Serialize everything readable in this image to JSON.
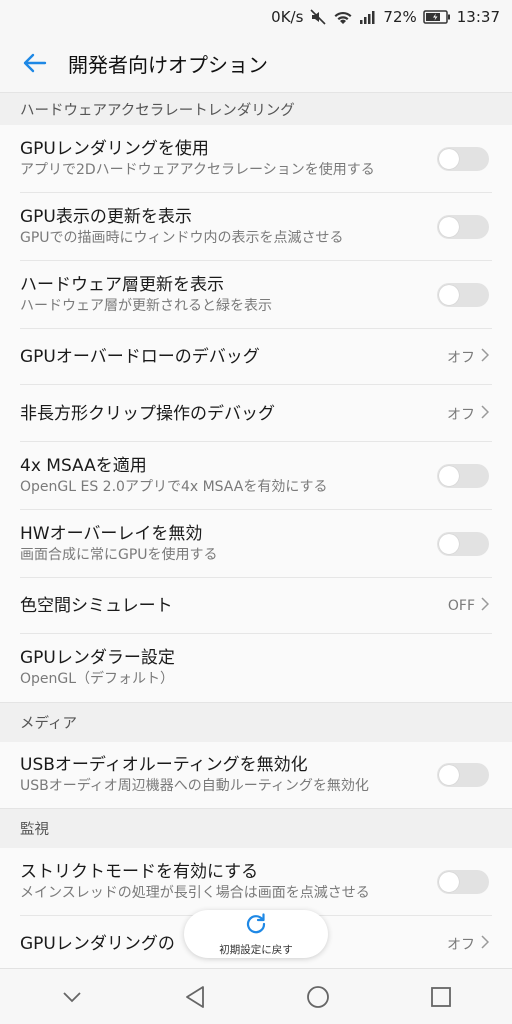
{
  "status_bar": {
    "net_speed": "0K/s",
    "battery": "72%",
    "time": "13:37"
  },
  "appbar": {
    "title": "開発者向けオプション"
  },
  "sections": {
    "hw": {
      "header": "ハードウェアアクセラレートレンダリング",
      "items": [
        {
          "title": "GPUレンダリングを使用",
          "subtitle": "アプリで2Dハードウェアアクセラレーションを使用する",
          "toggle": false
        },
        {
          "title": "GPU表示の更新を表示",
          "subtitle": "GPUでの描画時にウィンドウ内の表示を点滅させる",
          "toggle": false
        },
        {
          "title": "ハードウェア層更新を表示",
          "subtitle": "ハードウェア層が更新されると緑を表示",
          "toggle": false
        },
        {
          "title": "GPUオーバードローのデバッグ",
          "value": "オフ"
        },
        {
          "title": "非長方形クリップ操作のデバッグ",
          "value": "オフ"
        },
        {
          "title": "4x MSAAを適用",
          "subtitle": "OpenGL ES 2.0アプリで4x MSAAを有効にする",
          "toggle": false
        },
        {
          "title": "HWオーバーレイを無効",
          "subtitle": "画面合成に常にGPUを使用する",
          "toggle": false
        },
        {
          "title": "色空間シミュレート",
          "value": "OFF"
        },
        {
          "title": "GPUレンダラー設定",
          "subtitle": "OpenGL（デフォルト）"
        }
      ]
    },
    "media": {
      "header": "メディア",
      "items": [
        {
          "title": "USBオーディオルーティングを無効化",
          "subtitle": "USBオーディオ周辺機器への自動ルーティングを無効化",
          "toggle": false
        }
      ]
    },
    "monitor": {
      "header": "監視",
      "items": [
        {
          "title": "ストリクトモードを有効にする",
          "subtitle": "メインスレッドの処理が長引く場合は画面を点滅させる",
          "toggle": false
        },
        {
          "title": "GPUレンダリングの",
          "value": "オフ"
        }
      ]
    }
  },
  "reset_button": {
    "label": "初期設定に戻す"
  },
  "nav": {
    "icons": [
      "chevron-down-icon",
      "back-triangle-icon",
      "home-circle-icon",
      "recents-square-icon"
    ]
  },
  "colors": {
    "accent": "#1e88e5",
    "toggle_off": "#e2e2e2"
  }
}
